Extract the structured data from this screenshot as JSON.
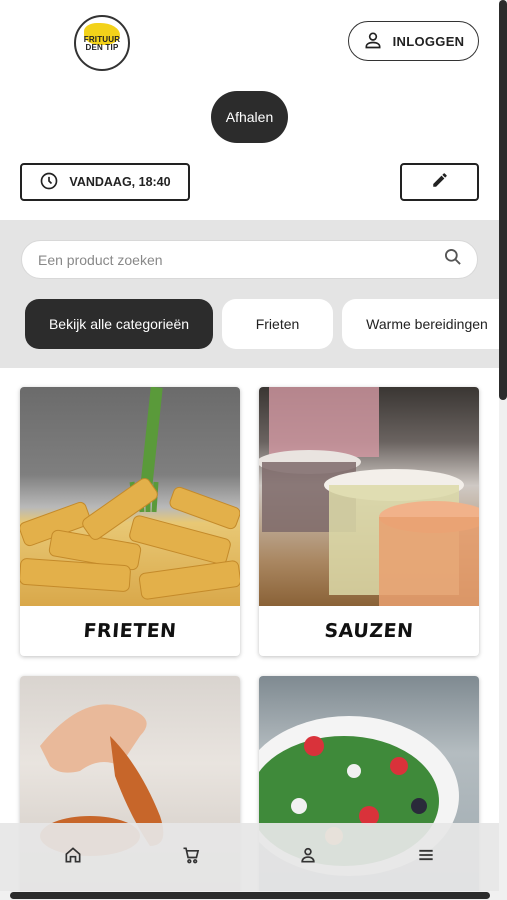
{
  "header": {
    "logo_line1": "FRITUUR",
    "logo_line2": "DEN TIP",
    "login_label": "INLOGGEN"
  },
  "order": {
    "mode_label": "Afhalen",
    "time_label": "VANDAAG, 18:40"
  },
  "search": {
    "placeholder": "Een product zoeken"
  },
  "categories": [
    {
      "label": "Bekijk alle categorieën",
      "active": true
    },
    {
      "label": "Frieten",
      "active": false
    },
    {
      "label": "Warme bereidingen",
      "active": false
    }
  ],
  "products": [
    {
      "name": "FRIETEN"
    },
    {
      "name": "SAUZEN"
    },
    {
      "name": ""
    },
    {
      "name": ""
    }
  ],
  "nav": {
    "items": [
      "home-icon",
      "cart-icon",
      "user-icon",
      "menu-icon"
    ]
  },
  "colors": {
    "primary": "#2c2c2c",
    "band": "#e4e4e4",
    "logo_yellow": "#f3d21a"
  }
}
